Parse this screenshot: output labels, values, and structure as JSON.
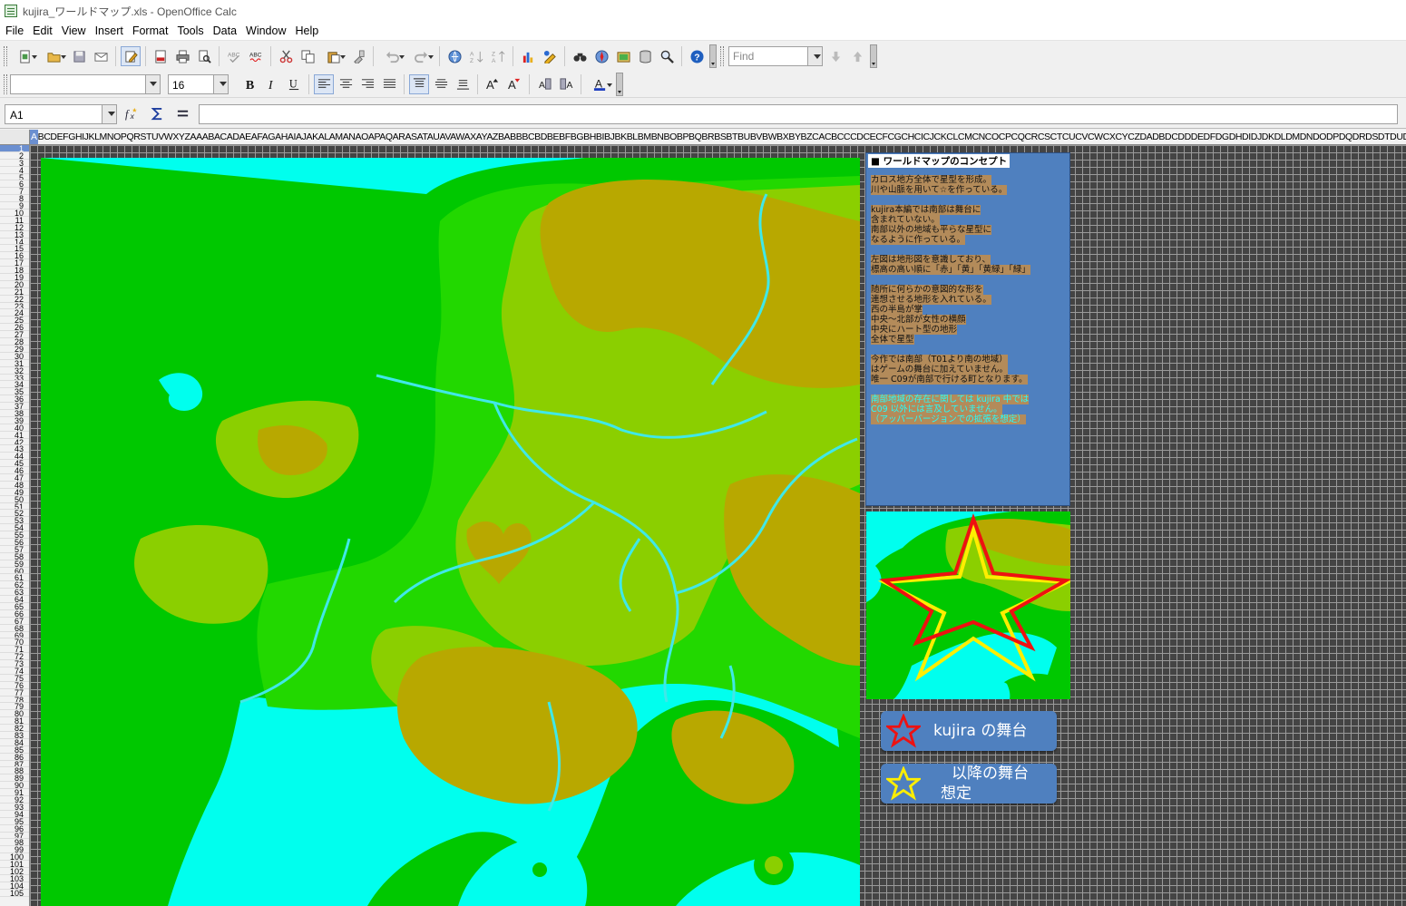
{
  "window": {
    "title": "kujira_ワールドマップ.xls - OpenOffice Calc"
  },
  "menu": [
    "File",
    "Edit",
    "View",
    "Insert",
    "Format",
    "Tools",
    "Data",
    "Window",
    "Help"
  ],
  "toolbar": {
    "find_placeholder": "Find",
    "font_name": "",
    "font_size": "16"
  },
  "formula": {
    "name_box": "A1",
    "content": ""
  },
  "sheet": {
    "columns": "ABCDEFGHIJKLMNOPQRSTUVWXYZAAABACADAEAFAGAHAIAJAKALAMANAOAPAQARASATAUAVAWAXAYAZBABBBCBDBEBFBGBHBIBJBKBLBMBNBOBPBQBRBSBTBUBVBWBXBYBZCACBCCCDCECFCGCHCICJCKCLCMCNCOCPCQCRCSCTCUCVCWCXCYCZDADBDCDDDEDFDGDHDIDJDKDLDMDNDODPDQDRDSDTDUDVDWDXDYDZEAEBECEDEEEFEGEHEIEJEKELEMENEOEPEQERESETEUEVEWEXEYEZFAFBFCFDFEFFFGFHFIFJFKFLFMFNFOFPFQFRFSFTFUFVFWFXFYFZGAGBGCGDGEGF",
    "selected_column": "A",
    "first_row": 1,
    "last_row": 105,
    "selected_row": 1
  },
  "concept": {
    "title": "■ ワールドマップのコンセプト",
    "lines": [
      {
        "text": "カロス地方全体で星型を形成。",
        "cyan": false
      },
      {
        "text": " 川や山脈を用いて☆を作っている。",
        "cyan": false
      },
      {
        "text": "",
        "cyan": false
      },
      {
        "text": "kujira本編では南部は舞台に",
        "cyan": false
      },
      {
        "text": " 含まれていない。",
        "cyan": false
      },
      {
        "text": " 南部以外の地域も平らな星型に",
        "cyan": false
      },
      {
        "text": " なるように作っている。",
        "cyan": false
      },
      {
        "text": "",
        "cyan": false
      },
      {
        "text": "左図は地形図を意識しており、",
        "cyan": false
      },
      {
        "text": " 標高の高い順に「赤」「黄」「黄緑」「緑」",
        "cyan": false
      },
      {
        "text": "",
        "cyan": false
      },
      {
        "text": "随所に何らかの意図的な形を",
        "cyan": false
      },
      {
        "text": " 連想させる地形を入れている。",
        "cyan": false
      },
      {
        "text": "   西の半島が掌",
        "cyan": false
      },
      {
        "text": "   中央～北部が女性の横顔",
        "cyan": false
      },
      {
        "text": "   中央にハート型の地形",
        "cyan": false
      },
      {
        "text": "   全体で星型",
        "cyan": false
      },
      {
        "text": "",
        "cyan": false
      },
      {
        "text": "今作では南部（T01より南の地域）",
        "cyan": false
      },
      {
        "text": " はゲームの舞台に加えていません。",
        "cyan": false
      },
      {
        "text": " 唯一 C09が南部で行ける町となります。",
        "cyan": false
      },
      {
        "text": "",
        "cyan": false
      },
      {
        "text": "南部地域の存在に関しては kujira 中では",
        "cyan": true
      },
      {
        "text": " C09 以外には言及していません。",
        "cyan": true
      },
      {
        "text": "（アッパーバージョンでの拡張を想定）",
        "cyan": true
      }
    ]
  },
  "legend": {
    "kujira_stage": "kujira の舞台",
    "future_stage_line1": "以降の舞台",
    "future_stage_line2": "想定"
  },
  "colors": {
    "sea": "#00ffee",
    "green": "#00c800",
    "lime": "#22d800",
    "yellow_green": "#8bcf00",
    "ochre": "#b8a800",
    "river": "#40e8e8",
    "panel_blue": "#4f80bf",
    "star_red": "#ee1111",
    "star_yellow": "#ffee00"
  },
  "icons": [
    "new-document-icon",
    "open-icon",
    "save-icon",
    "email-icon",
    "edit-mode-icon",
    "pdf-icon",
    "print-icon",
    "print-preview-icon",
    "spellcheck-icon",
    "autospell-icon",
    "cut-icon",
    "copy-icon",
    "paste-icon",
    "clone-format-icon",
    "undo-icon",
    "redo-icon",
    "hyperlink-icon",
    "sort-ascending-icon",
    "sort-descending-icon",
    "chart-icon",
    "draw-functions-icon",
    "find-replace-icon",
    "navigator-icon",
    "gallery-icon",
    "data-sources-icon",
    "zoom-icon",
    "help-icon"
  ]
}
